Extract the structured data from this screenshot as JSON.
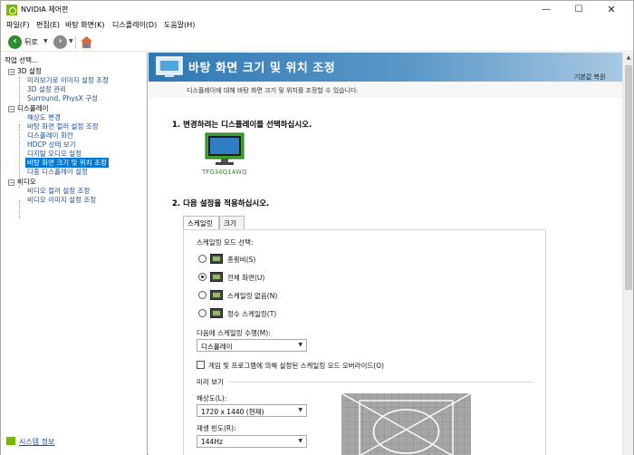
{
  "window": {
    "title": "NVIDIA 제어판",
    "min": "—",
    "max": "☐",
    "close": "✕"
  },
  "menu": [
    "파일(F)",
    "편집(E)",
    "바탕 화면(K)",
    "디스플레이(D)",
    "도움말(H)"
  ],
  "toolbar": {
    "back_label": "뒤로",
    "back_icon": "back-arrow-icon",
    "forward_icon": "forward-arrow-icon",
    "home_icon": "home-icon",
    "dropdown": "▼"
  },
  "left": {
    "header": "작업 선택...",
    "groups": [
      {
        "label": "3D 설정",
        "toggle": "−",
        "items": [
          "미리보기로 이미지 설정 조정",
          "3D 설정 관리",
          "Surround, PhysX 구성"
        ]
      },
      {
        "label": "디스플레이",
        "toggle": "−",
        "items": [
          "해상도 변경",
          "바탕 화면 컬러 설정 조정",
          "디스플레이 회전",
          "HDCP 상태 보기",
          "디지털 오디오 설정",
          "바탕 화면 크기 및 위치 조정",
          "다중 디스플레이 설정"
        ],
        "selected_index": 5
      },
      {
        "label": "비디오",
        "toggle": "−",
        "items": [
          "비디오 컬러 설정 조정",
          "비디오 이미지 설정 조정"
        ]
      }
    ],
    "system_info": "시스템 정보"
  },
  "page": {
    "title": "바탕 화면 크기 및 위치 조정",
    "restore": "기본값 복원",
    "description": "디스플레이에 대해 바탕 화면 크기 및 위치를 조정할 수 있습니다.",
    "section1": "1. 변경하려는 디스플레이를 선택하십시오.",
    "monitor_label": "TFG34Q14WQ",
    "section2": "2. 다음 설정을 적용하십시오.",
    "tabs": [
      "스케일링",
      "크기"
    ],
    "scaling_mode_label": "스케일링 모드 선택:",
    "modes": [
      {
        "label": "종횡비(S)",
        "selected": false
      },
      {
        "label": "전체 화면(U)",
        "selected": true
      },
      {
        "label": "스케일링 없음(N)",
        "selected": false
      },
      {
        "label": "정수 스케일링(T)",
        "selected": false
      }
    ],
    "perform_label": "다음에 스케일링 수행(M):",
    "perform_value": "디스플레이",
    "override_label": "게임 및 프로그램에 의해 설정된 스케일링 모드 오버라이드(O)",
    "preview_label": "미리 보기",
    "resolution_label": "해상도(L):",
    "resolution_value": "1720 x 1440 (현재)",
    "refresh_label": "재생 빈도(R):",
    "refresh_value": "144Hz"
  },
  "colors": {
    "accent": "#0078d7",
    "banner": "#2f78b4",
    "nvidia_green": "#76b900"
  }
}
